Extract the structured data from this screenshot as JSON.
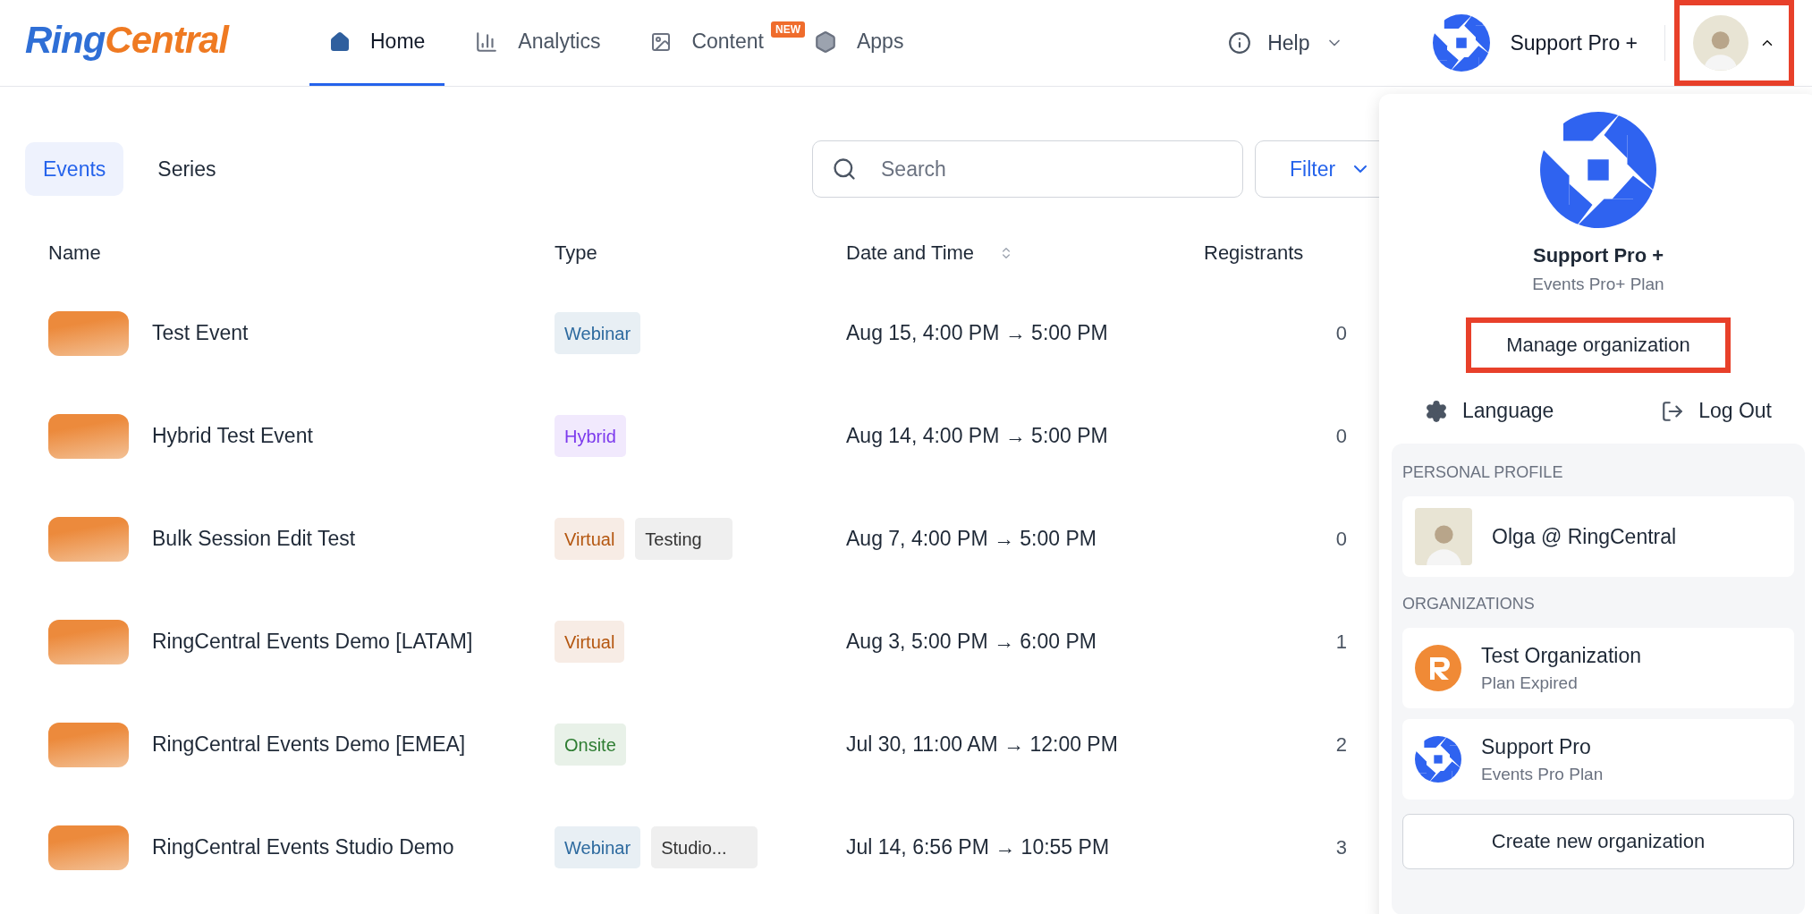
{
  "logo": {
    "parts": [
      "Ring",
      "Central"
    ]
  },
  "nav": [
    {
      "label": "Home",
      "selected": true
    },
    {
      "label": "Analytics",
      "selected": false
    },
    {
      "label": "Content",
      "selected": false,
      "badge": "NEW"
    },
    {
      "label": "Apps",
      "selected": false
    }
  ],
  "help": {
    "label": "Help"
  },
  "org_switcher": {
    "label": "Support Pro +"
  },
  "account_button": {
    "expanded": true,
    "highlighted": true
  },
  "view_tabs": [
    {
      "label": "Events",
      "selected": true
    },
    {
      "label": "Series",
      "selected": false
    }
  ],
  "search": {
    "placeholder": "Search"
  },
  "filter": {
    "label": "Filter"
  },
  "table": {
    "columns": [
      {
        "label": "Name"
      },
      {
        "label": "Type"
      },
      {
        "label": "Date and Time",
        "sortable": true
      },
      {
        "label": "Registrants"
      }
    ],
    "rows": [
      {
        "name": "Test Event",
        "tags": [
          {
            "label": "Webinar",
            "kind": "type",
            "color": "#2d6a9f"
          }
        ],
        "date": "Aug 15, 4:00 PM → 5:00 PM",
        "registrants": "0"
      },
      {
        "name": "Hybrid Test Event",
        "tags": [
          {
            "label": "Hybrid",
            "kind": "type",
            "color": "#7c3aed"
          }
        ],
        "date": "Aug 14, 4:00 PM → 5:00 PM",
        "registrants": "0"
      },
      {
        "name": "Bulk Session Edit Test",
        "tags": [
          {
            "label": "Virtual",
            "kind": "type",
            "color": "#b4560f"
          },
          {
            "label": "Testing",
            "kind": "label",
            "color": "#333333"
          }
        ],
        "date": "Aug 7, 4:00 PM → 5:00 PM",
        "registrants": "0"
      },
      {
        "name": "RingCentral Events Demo [LATAM]",
        "tags": [
          {
            "label": "Virtual",
            "kind": "type",
            "color": "#b4560f"
          }
        ],
        "date": "Aug 3, 5:00 PM → 6:00 PM",
        "registrants": "1"
      },
      {
        "name": "RingCentral Events Demo [EMEA]",
        "tags": [
          {
            "label": "Onsite",
            "kind": "type",
            "color": "#2e7d32"
          }
        ],
        "date": "Jul 30, 11:00 AM → 12:00 PM",
        "registrants": "2"
      },
      {
        "name": "RingCentral Events Studio Demo",
        "tags": [
          {
            "label": "Webinar",
            "kind": "type",
            "color": "#2d6a9f"
          },
          {
            "label": "Studio...",
            "kind": "label",
            "color": "#333333"
          }
        ],
        "date": "Jul 14, 6:56 PM → 10:55 PM",
        "registrants": "3"
      }
    ]
  },
  "account_menu": {
    "org_name": "Support Pro +",
    "plan": "Events Pro+ Plan",
    "manage": {
      "label": "Manage organization",
      "highlighted": true
    },
    "actions": [
      {
        "label": "Language"
      },
      {
        "label": "Log Out"
      }
    ],
    "personal_heading": "PERSONAL PROFILE",
    "profile": {
      "name": "Olga @ RingCentral"
    },
    "orgs_heading": "ORGANIZATIONS",
    "organizations": [
      {
        "name": "Test Organization",
        "plan": "Plan Expired",
        "kind": "letter"
      },
      {
        "name": "Support Pro",
        "plan": "Events Pro Plan",
        "kind": "pinwheel"
      }
    ],
    "create": {
      "label": "Create new organization"
    }
  }
}
